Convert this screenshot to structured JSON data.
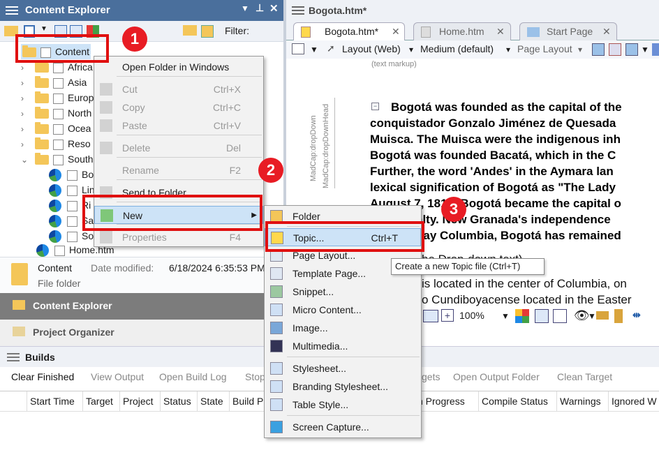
{
  "left_pane": {
    "title": "Content Explorer",
    "filter_label": "Filter:",
    "tree": {
      "root": "Content",
      "items": [
        "Africa",
        "Asia",
        "Europe",
        "North",
        "Ocea",
        "Reso",
        "South"
      ],
      "south_children": [
        "Bo",
        "Lin",
        "Ri",
        "Sa",
        "So"
      ],
      "home": "Home.htm"
    },
    "details": {
      "name": "Content",
      "type": "File folder",
      "date_label": "Date modified:",
      "date_value": "6/18/2024 6:35:53 PM"
    },
    "nav": [
      "Content Explorer",
      "Project Organizer"
    ]
  },
  "builds": {
    "title": "Builds",
    "toolbar": [
      "Clear Finished",
      "View Output",
      "Open Build Log",
      "Stop",
      "gets",
      "Open Output Folder",
      "Clean Target"
    ],
    "columns": [
      "Start Time",
      "Target",
      "Project",
      "Status",
      "State",
      "Build P",
      "sh Progress",
      "Compile Status",
      "Warnings",
      "Ignored W"
    ]
  },
  "editor": {
    "window_title": "Bogota.htm*",
    "tabs": [
      "Bogota.htm*",
      "Home.htm",
      "Start Page"
    ],
    "viewbar": {
      "layout": "Layout (Web)",
      "medium": "Medium (default)",
      "page_layout": "Page Layout"
    },
    "text_markup_label": "(text markup)",
    "margin_labels": [
      "MadCap:dropDown",
      "MadCap:dropDownHead"
    ],
    "bold_lines": [
      "Bogotá was founded as the capital of the",
      "conquistador Gonzalo Jiménez de Quesada",
      "Muisca. The Muisca were the indigenous inh",
      "Bogotá was founded Bacatá, which in the C",
      "Further, the word 'Andes' in the Aymara lan",
      "lexical signification of Bogotá as \"The Lady",
      "August 7, 1819, Bogotá became the capital o",
      "alty. New Granada's independence",
      "day Columbia, Bogotá has remained"
    ],
    "normal_lines": [
      "he Drop-down text)",
      "is located in the center of Columbia, on",
      "o Cundiboyacense located in the Easter"
    ],
    "zoom": "100%"
  },
  "context_menu": {
    "items": [
      {
        "label": "Open Folder in Windows",
        "shortcut": "",
        "disabled": false
      },
      {
        "label": "Cut",
        "shortcut": "Ctrl+X",
        "disabled": true
      },
      {
        "label": "Copy",
        "shortcut": "Ctrl+C",
        "disabled": true
      },
      {
        "label": "Paste",
        "shortcut": "Ctrl+V",
        "disabled": true
      },
      {
        "label": "Delete",
        "shortcut": "Del",
        "disabled": true
      },
      {
        "label": "Rename",
        "shortcut": "F2",
        "disabled": true
      },
      {
        "label": "Send to Folder",
        "shortcut": "",
        "disabled": false
      },
      {
        "label": "New",
        "shortcut": "",
        "disabled": false
      },
      {
        "label": "Properties",
        "shortcut": "F4",
        "disabled": true
      }
    ]
  },
  "submenu": {
    "items": [
      {
        "label": "Folder",
        "shortcut": ""
      },
      {
        "label": "Topic...",
        "shortcut": "Ctrl+T"
      },
      {
        "label": "Page Layout...",
        "shortcut": ""
      },
      {
        "label": "Template Page...",
        "shortcut": ""
      },
      {
        "label": "Snippet...",
        "shortcut": ""
      },
      {
        "label": "Micro Content...",
        "shortcut": ""
      },
      {
        "label": "Image...",
        "shortcut": ""
      },
      {
        "label": "Multimedia...",
        "shortcut": ""
      },
      {
        "label": "Stylesheet...",
        "shortcut": ""
      },
      {
        "label": "Branding Stylesheet...",
        "shortcut": ""
      },
      {
        "label": "Table Style...",
        "shortcut": ""
      },
      {
        "label": "Screen Capture...",
        "shortcut": ""
      }
    ]
  },
  "tooltip": "Create a new Topic file (Ctrl+T)",
  "callouts": [
    "1",
    "2",
    "3"
  ],
  "colors": {
    "title_bar": "#4a6f9c",
    "highlight": "#cde3f7",
    "callout": "#e81c24"
  }
}
